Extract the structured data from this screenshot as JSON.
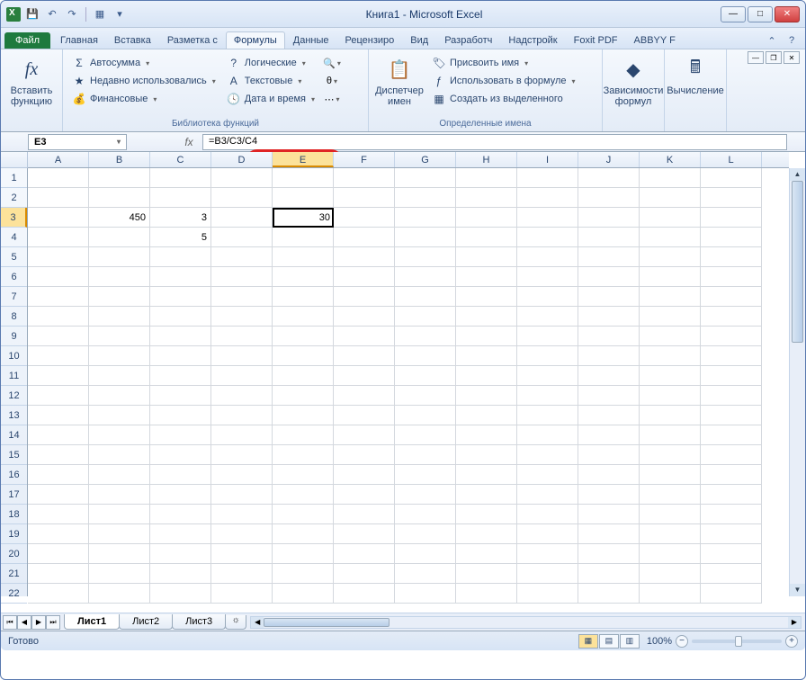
{
  "app": {
    "title": "Книга1 - Microsoft Excel"
  },
  "window": {
    "minimize": "—",
    "maximize": "□",
    "close": "✕"
  },
  "qat": {
    "save": "💾",
    "undo": "↶",
    "redo": "↷",
    "more1": "▦",
    "dd": "▾"
  },
  "tabs": {
    "file": "Файл",
    "items": [
      "Главная",
      "Вставка",
      "Разметка с",
      "Формулы",
      "Данные",
      "Рецензиро",
      "Вид",
      "Разработч",
      "Надстройк",
      "Foxit PDF",
      "ABBYY F"
    ],
    "active_index": 3
  },
  "ribbon": {
    "insert_fn": {
      "label": "Вставить\nфункцию",
      "fx": "fx"
    },
    "lib_group": "Библиотека функций",
    "lib_items": {
      "autosum": "Автосумма",
      "recent": "Недавно использовались",
      "financial": "Финансовые",
      "logical": "Логические",
      "text": "Текстовые",
      "datetime": "Дата и время"
    },
    "name_mgr": {
      "label": "Диспетчер\nимен"
    },
    "names_group": "Определенные имена",
    "names_items": {
      "assign": "Присвоить имя",
      "use": "Использовать в формуле",
      "create": "Создать из выделенного"
    },
    "deps": {
      "label": "Зависимости\nформул"
    },
    "calc": {
      "label": "Вычисление"
    }
  },
  "namebox": {
    "value": "E3",
    "dd": "▾"
  },
  "formula": {
    "fx": "fx",
    "value": "=B3/C3/C4",
    "expand": "▾"
  },
  "columns": [
    "A",
    "B",
    "C",
    "D",
    "E",
    "F",
    "G",
    "H",
    "I",
    "J",
    "K",
    "L"
  ],
  "rows_count": 22,
  "selected": {
    "col": "E",
    "row": 3
  },
  "cells": {
    "B3": "450",
    "C3": "3",
    "C4": "5",
    "E3": "30"
  },
  "sheets": {
    "items": [
      "Лист1",
      "Лист2",
      "Лист3"
    ],
    "active": 0,
    "insert": "☼"
  },
  "status": {
    "ready": "Готово",
    "zoom": "100%",
    "minus": "−",
    "plus": "+"
  },
  "views": {
    "normal": "▦",
    "layout": "▤",
    "pagebreak": "▥"
  }
}
